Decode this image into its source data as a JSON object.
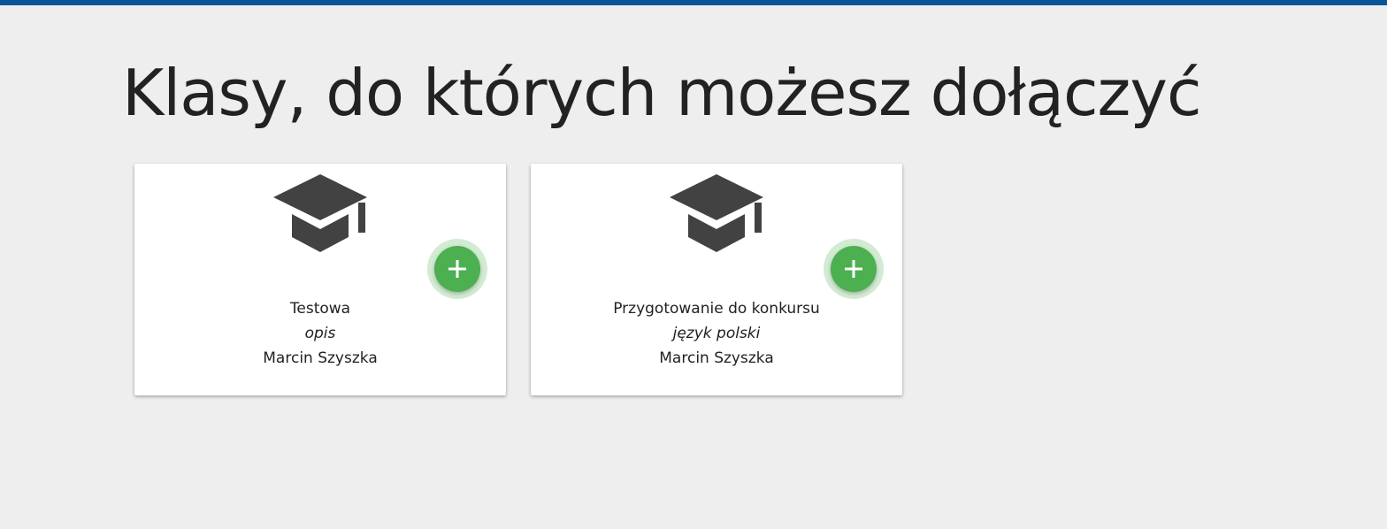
{
  "header": {
    "title": "Klasy, do których możesz dołączyć"
  },
  "colors": {
    "top_bar": "#0a5595",
    "join_button": "#4caf50",
    "icon": "#424242"
  },
  "classes": [
    {
      "name": "Testowa",
      "description": "opis",
      "teacher": "Marcin Szyszka",
      "icon": "graduation-cap-icon",
      "action_icon": "plus-icon"
    },
    {
      "name": "Przygotowanie do konkursu",
      "description": "język polski",
      "teacher": "Marcin Szyszka",
      "icon": "graduation-cap-icon",
      "action_icon": "plus-icon"
    }
  ]
}
